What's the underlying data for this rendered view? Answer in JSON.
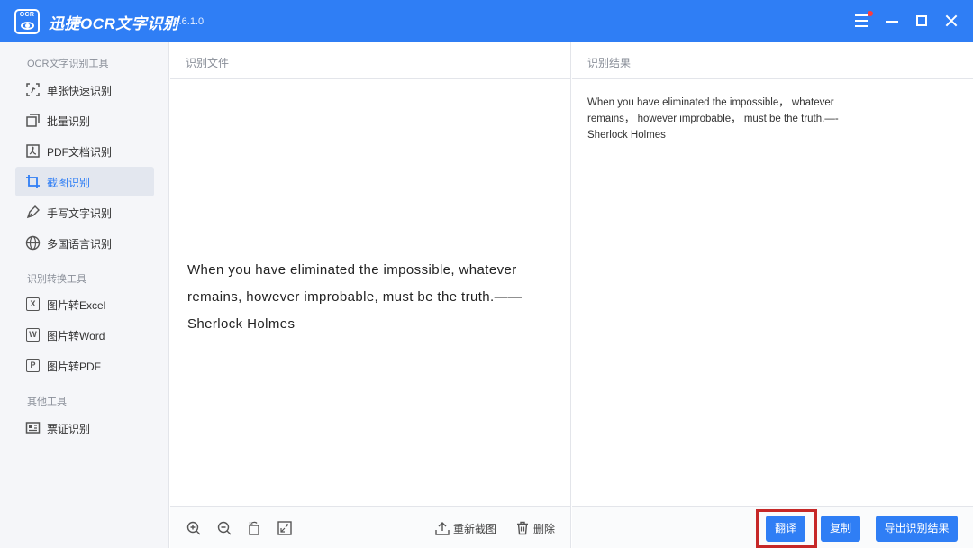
{
  "app": {
    "logo_text": "OCR",
    "title": "迅捷OCR文字识别",
    "version": "v8.6.1.0"
  },
  "sidebar": {
    "groups": [
      {
        "title": "OCR文字识别工具",
        "items": [
          {
            "label": "单张快速识别",
            "icon": "single-scan-icon"
          },
          {
            "label": "批量识别",
            "icon": "batch-icon"
          },
          {
            "label": "PDF文档识别",
            "icon": "pdf-doc-icon"
          },
          {
            "label": "截图识别",
            "icon": "crop-icon",
            "active": true
          },
          {
            "label": "手写文字识别",
            "icon": "pen-icon"
          },
          {
            "label": "多国语言识别",
            "icon": "globe-icon"
          }
        ]
      },
      {
        "title": "识别转换工具",
        "items": [
          {
            "label": "图片转Excel",
            "icon": "excel-icon",
            "glyph": "X"
          },
          {
            "label": "图片转Word",
            "icon": "word-icon",
            "glyph": "W"
          },
          {
            "label": "图片转PDF",
            "icon": "pdf-icon",
            "glyph": "P"
          }
        ]
      },
      {
        "title": "其他工具",
        "items": [
          {
            "label": "票证识别",
            "icon": "ticket-icon"
          }
        ]
      }
    ]
  },
  "left_panel": {
    "title": "识别文件",
    "content_lines": [
      "When you have eliminated the impossible, whatever",
      "remains, however improbable, must be the truth.——",
      "Sherlock Holmes"
    ],
    "toolbar": {
      "zoom_in_icon": "zoom-in-icon",
      "zoom_out_icon": "zoom-out-icon",
      "rotate_icon": "rotate-icon",
      "fit_icon": "fit-icon",
      "recapture_label": "重新截图",
      "delete_label": "删除"
    }
  },
  "right_panel": {
    "title": "识别结果",
    "content_lines": [
      "When you have eliminated the impossible， whatever",
      "remains， however improbable， must be the truth.—-",
      "Sherlock Holmes"
    ],
    "buttons": {
      "translate": "翻译",
      "copy": "复制",
      "export": "导出识别结果"
    }
  },
  "colors": {
    "accent": "#2f7ef5",
    "highlight": "#c62828",
    "notification_dot": "#ff3b3b"
  }
}
